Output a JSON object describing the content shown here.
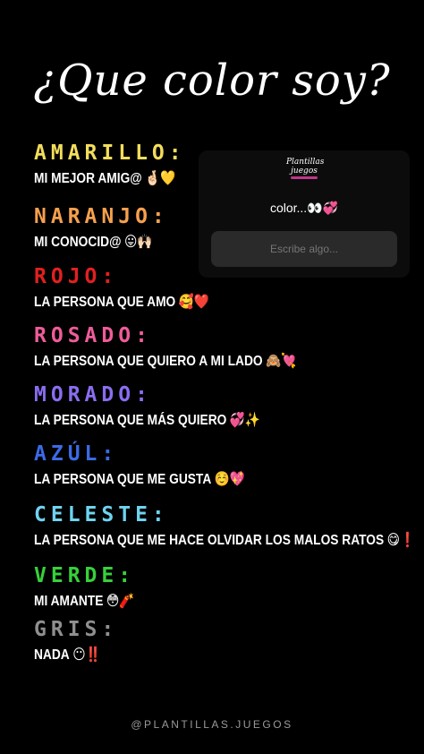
{
  "title": "¿Que color soy?",
  "entries": [
    {
      "category": "AMARILLO:",
      "color": "#f3dd5c",
      "description": "MI MEJOR AMIG@",
      "emoji": "🤞🏻💛"
    },
    {
      "category": "NARANJO:",
      "color": "#f6a04d",
      "description": "MI CONOCID@",
      "emoji": "😛🙌🏻"
    },
    {
      "category": "ROJO:",
      "color": "#e2201f",
      "description": "LA PERSONA QUE AMO",
      "emoji": "🥰❤️"
    },
    {
      "category": "ROSADO:",
      "color": "#ef5c9a",
      "description": "LA PERSONA QUE QUIERO A MI LADO",
      "emoji": "🙈💘"
    },
    {
      "category": "MORADO:",
      "color": "#8a6df0",
      "description": "LA PERSONA QUE MÁS QUIERO",
      "emoji": "💞✨"
    },
    {
      "category": "AZÚL:",
      "color": "#3c6ae6",
      "description": "LA PERSONA QUE ME GUSTA",
      "emoji": "☺️💖"
    },
    {
      "category": "CELESTE:",
      "color": "#6fd3f0",
      "description": "LA PERSONA QUE ME HACE OLVIDAR LOS MALOS RATOS",
      "emoji": "😋❗"
    },
    {
      "category": "VERDE:",
      "color": "#36d13a",
      "description": "MI AMANTE",
      "emoji": "😳🧨"
    },
    {
      "category": "GRIS:",
      "color": "#8f8f8f",
      "description": "NADA",
      "emoji": "😶‼️"
    }
  ],
  "sticker": {
    "logo_line1": "Plantillas",
    "logo_line2": "juegos",
    "prompt": "color...👀💞",
    "placeholder": "Escribe algo..."
  },
  "footer": "@PLANTILLAS.JUEGOS"
}
